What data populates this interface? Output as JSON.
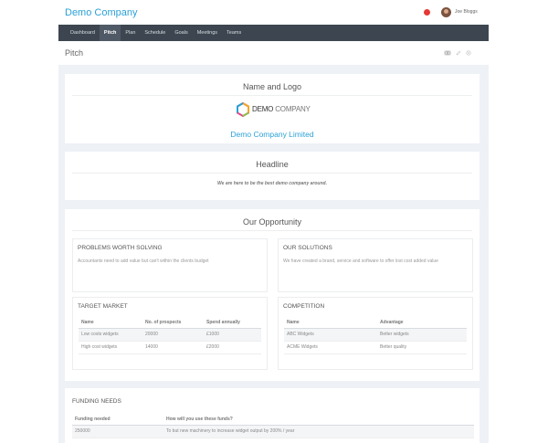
{
  "header": {
    "brand": "Demo Company",
    "user_name": "Joe Bloggs"
  },
  "nav": {
    "tabs": [
      {
        "label": "Dashboard",
        "active": false
      },
      {
        "label": "Pitch",
        "active": true
      },
      {
        "label": "Plan",
        "active": false
      },
      {
        "label": "Schedule",
        "active": false
      },
      {
        "label": "Goals",
        "active": false
      },
      {
        "label": "Meetings",
        "active": false
      },
      {
        "label": "Teams",
        "active": false
      }
    ]
  },
  "page": {
    "title": "Pitch"
  },
  "name_logo": {
    "title": "Name and Logo",
    "logo_word_dark": "DEMO",
    "logo_word_light": "COMPANY",
    "company_name": "Demo Company Limited"
  },
  "headline": {
    "title": "Headline",
    "text": "We are here to be the best demo company around."
  },
  "opportunity": {
    "title": "Our Opportunity",
    "problems": {
      "title": "PROBLEMS WORTH SOLVING",
      "text": "Accountants need to add value but can't within the clients budget"
    },
    "solutions": {
      "title": "OUR SOLUTIONS",
      "text": "We have created a brand, service and software to offer lost cost added value"
    },
    "target_market": {
      "title": "TARGET MARKET",
      "columns": [
        "Name",
        "No. of prospects",
        "Spend annually"
      ],
      "rows": [
        [
          "Low costs widgets",
          "20000",
          "£1000"
        ],
        [
          "High cost widgets",
          "14000",
          "£2000"
        ]
      ]
    },
    "competition": {
      "title": "COMPETITION",
      "columns": [
        "Name",
        "Advantage"
      ],
      "rows": [
        [
          "ABC Widgets",
          "Better widgets"
        ],
        [
          "ACME Widgets",
          "Better quality"
        ]
      ]
    }
  },
  "funding": {
    "title": "FUNDING NEEDS",
    "columns": [
      "Funding needed",
      "How will you use these funds?"
    ],
    "rows": [
      [
        "250000",
        "To but new machinery to increase widget output by 200% / year"
      ]
    ]
  },
  "colors": {
    "accent": "#2ba1d6",
    "nav_bg": "#3d4650",
    "notification": "#e53935"
  },
  "icons": {
    "view": "eye-icon",
    "edit": "pencil-icon",
    "settings": "gear-icon"
  }
}
